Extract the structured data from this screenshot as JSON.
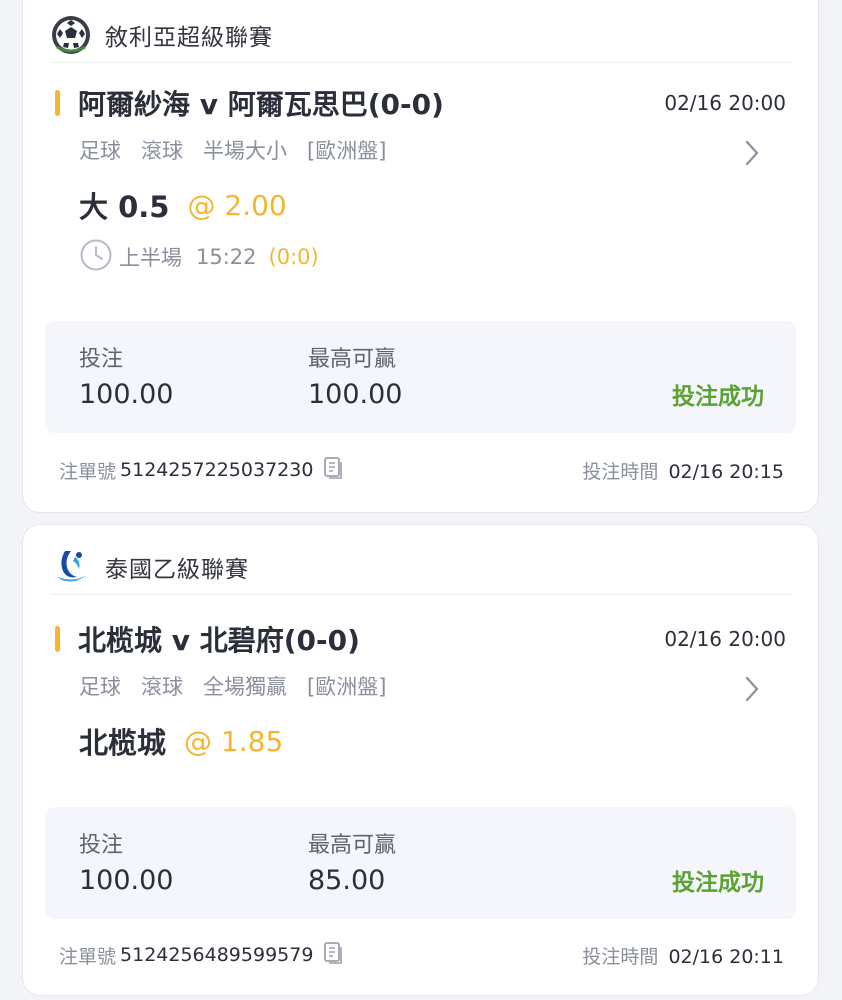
{
  "colors": {
    "accent": "#f5b52e",
    "success": "#5aa233",
    "muted": "#8a8f9c",
    "text": "#2b2f3a",
    "page_bg": "#f3f4f8",
    "stake_bg": "#f4f6fb"
  },
  "bets": [
    {
      "league": {
        "name": "敘利亞超級聯賽",
        "icon": "soccer-ball-icon"
      },
      "match_title": "阿爾紗海 v 阿爾瓦思巴(0-0)",
      "match_time": "02/16 20:00",
      "market": {
        "sport": "足球",
        "mode": "滾球",
        "type": "半場大小",
        "odds_format": "[歐洲盤]"
      },
      "pick": "大 0.5",
      "odds": "@ 2.00",
      "live": {
        "period": "上半場",
        "clock": "15:22",
        "score": "(0:0)"
      },
      "stake_label": "投注",
      "stake": "100.00",
      "max_win_label": "最高可贏",
      "max_win": "100.00",
      "status": "投注成功",
      "order_label": "注單號",
      "order_no": "5124257225037230",
      "bet_time_label": "投注時間",
      "bet_time": "02/16 20:15"
    },
    {
      "league": {
        "name": "泰國乙級聯賽",
        "icon": "thai-league-logo-icon"
      },
      "match_title": "北榄城 v 北碧府(0-0)",
      "match_time": "02/16 20:00",
      "market": {
        "sport": "足球",
        "mode": "滾球",
        "type": "全場獨贏",
        "odds_format": "[歐洲盤]"
      },
      "pick": "北榄城",
      "odds": "@ 1.85",
      "stake_label": "投注",
      "stake": "100.00",
      "max_win_label": "最高可贏",
      "max_win": "85.00",
      "status": "投注成功",
      "order_label": "注單號",
      "order_no": "5124256489599579",
      "bet_time_label": "投注時間",
      "bet_time": "02/16 20:11"
    }
  ]
}
